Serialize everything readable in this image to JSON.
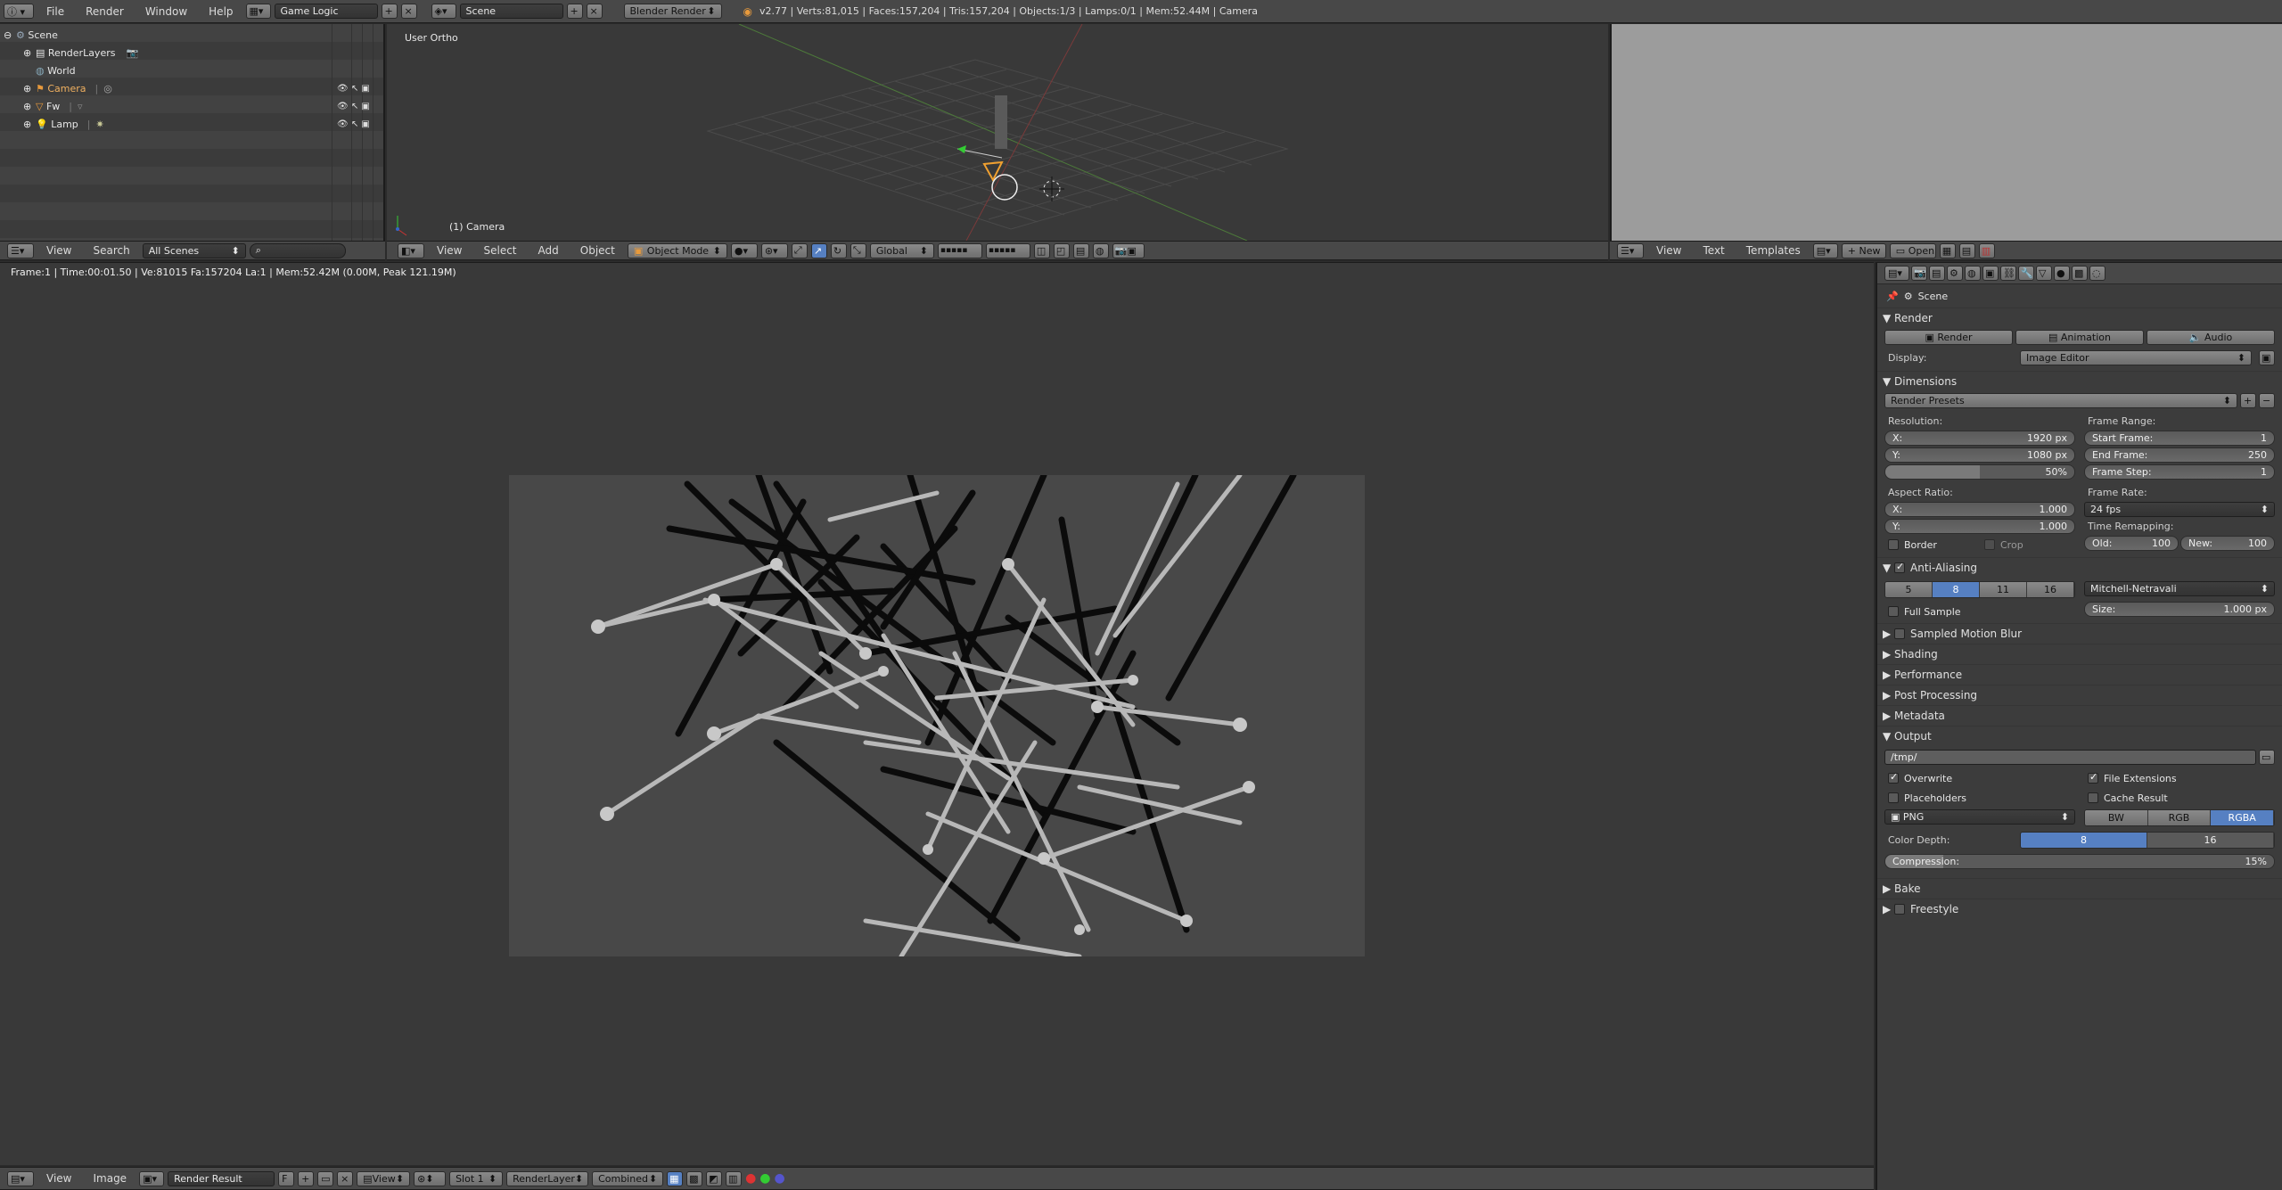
{
  "topbar": {
    "menus": [
      "File",
      "Render",
      "Window",
      "Help"
    ],
    "screen_layout": "Game Logic",
    "scene": "Scene",
    "engine": "Blender Render",
    "stats": "v2.77 | Verts:81,015 | Faces:157,204 | Tris:157,204 | Objects:1/3 | Lamps:0/1 | Mem:52.44M | Camera"
  },
  "outliner": {
    "items": [
      {
        "label": "Scene"
      },
      {
        "label": "RenderLayers"
      },
      {
        "label": "World"
      },
      {
        "label": "Camera"
      },
      {
        "label": "Fw"
      },
      {
        "label": "Lamp"
      }
    ],
    "header": {
      "view": "View",
      "search": "Search",
      "filter": "All Scenes"
    }
  },
  "viewport3d": {
    "label": "User Ortho",
    "object_label": "(1) Camera",
    "header": {
      "view": "View",
      "select": "Select",
      "add": "Add",
      "object": "Object",
      "mode": "Object Mode",
      "orientation": "Global"
    }
  },
  "texteditor": {
    "header": {
      "view": "View",
      "text": "Text",
      "templates": "Templates",
      "new": "New",
      "open": "Open"
    }
  },
  "image_editor": {
    "info": "Frame:1 | Time:00:01.50 | Ve:81015 Fa:157204 La:1 | Mem:52.42M (0.00M, Peak 121.19M)",
    "header": {
      "view": "View",
      "image": "Image",
      "image_name": "Render Result",
      "view2": "View",
      "slot": "Slot 1",
      "layer": "RenderLayer",
      "pass": "Combined"
    }
  },
  "properties": {
    "context": "Scene",
    "render": {
      "title": "Render",
      "render_btn": "Render",
      "animation_btn": "Animation",
      "audio_btn": "Audio",
      "display_label": "Display:",
      "display_value": "Image Editor"
    },
    "dimensions": {
      "title": "Dimensions",
      "presets": "Render Presets",
      "resolution_label": "Resolution:",
      "res_x_label": "X:",
      "res_x": "1920 px",
      "res_y_label": "Y:",
      "res_y": "1080 px",
      "res_pct": "50%",
      "res_pct_value": 0.5,
      "frame_range_label": "Frame Range:",
      "start_label": "Start Frame:",
      "start": "1",
      "end_label": "End Frame:",
      "end": "250",
      "step_label": "Frame Step:",
      "step": "1",
      "aspect_label": "Aspect Ratio:",
      "asp_x_label": "X:",
      "asp_x": "1.000",
      "asp_y_label": "Y:",
      "asp_y": "1.000",
      "frame_rate_label": "Frame Rate:",
      "frame_rate": "24 fps",
      "remap_label": "Time Remapping:",
      "old_label": "Old:",
      "old": "100",
      "new_label": "New:",
      "new": "100",
      "border": "Border",
      "crop": "Crop"
    },
    "aa": {
      "title": "Anti-Aliasing",
      "samples": [
        "5",
        "8",
        "11",
        "16"
      ],
      "selected": "8",
      "filter": "Mitchell-Netravali",
      "full_sample": "Full Sample",
      "size_label": "Size:",
      "size": "1.000 px"
    },
    "collapsed": [
      "Sampled Motion Blur",
      "Shading",
      "Performance",
      "Post Processing",
      "Metadata"
    ],
    "output": {
      "title": "Output",
      "path": "/tmp/",
      "overwrite": "Overwrite",
      "file_ext": "File Extensions",
      "placeholders": "Placeholders",
      "cache": "Cache Result",
      "format": "PNG",
      "modes": [
        "BW",
        "RGB",
        "RGBA"
      ],
      "mode_selected": "RGBA",
      "depth_label": "Color Depth:",
      "depths": [
        "8",
        "16"
      ],
      "depth_selected": "8",
      "compression_label": "Compression:",
      "compression": "15%",
      "compression_value": 0.15
    },
    "bottom": [
      "Bake",
      "Freestyle"
    ]
  }
}
